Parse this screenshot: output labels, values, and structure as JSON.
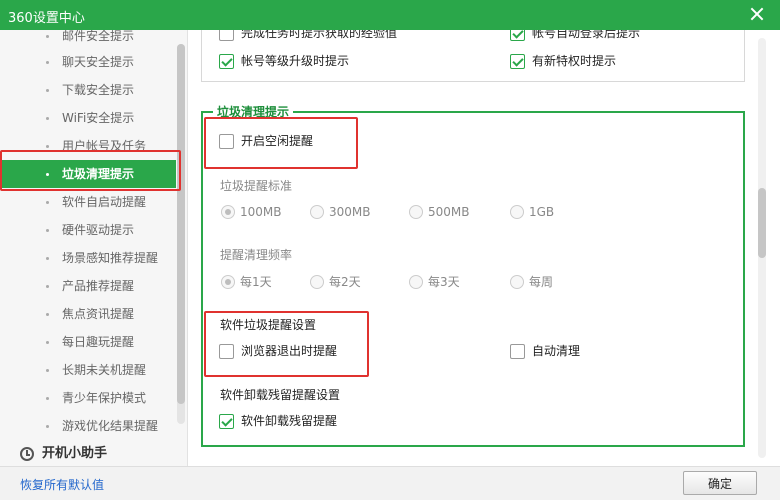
{
  "window": {
    "title": "360设置中心"
  },
  "sidebar": {
    "items": [
      {
        "label": "邮件安全提示"
      },
      {
        "label": "聊天安全提示"
      },
      {
        "label": "下载安全提示"
      },
      {
        "label": "WiFi安全提示"
      },
      {
        "label": "用户帐号及任务"
      },
      {
        "label": "垃圾清理提示"
      },
      {
        "label": "软件自启动提醒"
      },
      {
        "label": "硬件驱动提示"
      },
      {
        "label": "场景感知推荐提醒"
      },
      {
        "label": "产品推荐提醒"
      },
      {
        "label": "焦点资讯提醒"
      },
      {
        "label": "每日趣玩提醒"
      },
      {
        "label": "长期未关机提醒"
      },
      {
        "label": "青少年保护模式"
      },
      {
        "label": "游戏优化结果提醒"
      }
    ],
    "group": {
      "label": "开机小助手"
    }
  },
  "top_section": {
    "cut_left": "完成任务时提示获取的经验值",
    "cut_right": "帐号自动登录后提示",
    "level_up": "帐号等级升级时提示",
    "new_privilege": "有新特权时提示"
  },
  "junk_section": {
    "legend": "垃圾清理提示",
    "idle_reminder": "开启空闲提醒",
    "standard_label": "垃圾提醒标准",
    "sizes": [
      "100MB",
      "300MB",
      "500MB",
      "1GB"
    ],
    "frequency_label": "提醒清理频率",
    "frequencies": [
      "每1天",
      "每2天",
      "每3天",
      "每周"
    ],
    "software_label": "软件垃圾提醒设置",
    "browser_exit": "浏览器退出时提醒",
    "auto_clean": "自动清理",
    "uninstall_label": "软件卸载残留提醒设置",
    "uninstall_reminder": "软件卸载残留提醒"
  },
  "footer": {
    "restore_label": "恢复所有默认值",
    "ok_label": "确定"
  }
}
